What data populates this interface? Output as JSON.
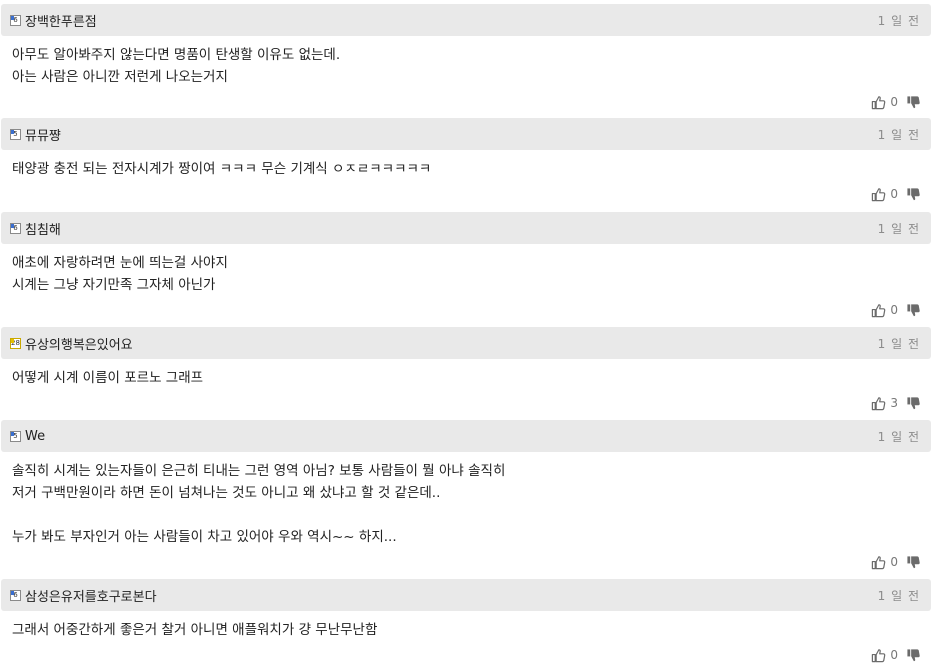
{
  "comments": [
    {
      "nickname": "장백한푸른점",
      "level": "6",
      "level_style": "blue",
      "time": "1 일 전",
      "body": "아무도 알아봐주지 않는다면 명품이 탄생할 이유도 없는데.\n아는 사람은 아니깐 저런게 나오는거지",
      "likes": "0",
      "body_height": 54
    },
    {
      "nickname": "뮤뮤쨩",
      "level": "5",
      "level_style": "blue",
      "time": "1 일 전",
      "body": "태양광 충전 되는 전자시계가 짱이여 ㅋㅋㅋ 무슨 기계식 ㅇㅈㄹㅋㅋㅋㅋㅋ",
      "likes": "0",
      "body_height": 32
    },
    {
      "nickname": "침침해",
      "level": "6",
      "level_style": "blue",
      "time": "1 일 전",
      "body": "애초에 자랑하려면 눈에 띄는걸 사야지\n시계는 그냥 자기만족 그자체 아닌가",
      "likes": "0",
      "body_height": 54
    },
    {
      "nickname": "유상의행복은있어요",
      "level": "28",
      "level_style": "yellow",
      "time": "1 일 전",
      "body": "어떻게 시계 이름이 포르노 그래프",
      "likes": "3",
      "body_height": 32
    },
    {
      "nickname": "We",
      "level": "5",
      "level_style": "blue",
      "time": "1 일 전",
      "body": "솔직히 시계는 있는자들이 은근히 티내는 그런 영역 아님? 보통 사람들이 뭘 아냐 솔직히\n저거 구백만원이라 하면 돈이 넘쳐나는 것도 아니고 왜 샀냐고 할 것 같은데..\n\n누가 봐도 부자인거 아는 사람들이 차고 있어야 우와 역시~~ 하지...",
      "likes": "0",
      "body_height": 98
    },
    {
      "nickname": "삼성은유저를호구로본다",
      "level": "6",
      "level_style": "blue",
      "time": "1 일 전",
      "body": "그래서 어중간하게 좋은거 찰거 아니면 애플워치가 걍 무난무난함",
      "likes": "0",
      "body_height": 32
    }
  ],
  "icons": {
    "like": "thumbs-up-icon",
    "dislike": "thumbs-down-icon"
  }
}
